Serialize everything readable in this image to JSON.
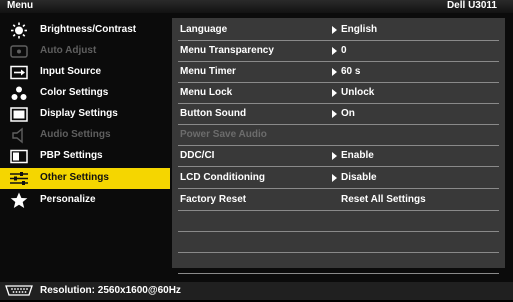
{
  "header": {
    "title": "Menu",
    "model": "Dell U3011"
  },
  "sidebar": {
    "items": [
      {
        "label": "Brightness/Contrast",
        "icon": "brightness-icon",
        "state": "normal"
      },
      {
        "label": "Auto Adjust",
        "icon": "auto-adjust-icon",
        "state": "disabled"
      },
      {
        "label": "Input Source",
        "icon": "input-source-icon",
        "state": "normal"
      },
      {
        "label": "Color Settings",
        "icon": "color-settings-icon",
        "state": "normal"
      },
      {
        "label": "Display Settings",
        "icon": "display-settings-icon",
        "state": "normal"
      },
      {
        "label": "Audio Settings",
        "icon": "speaker-icon",
        "state": "disabled"
      },
      {
        "label": "PBP Settings",
        "icon": "pbp-icon",
        "state": "normal"
      },
      {
        "label": "Other Settings",
        "icon": "sliders-icon",
        "state": "selected"
      },
      {
        "label": "Personalize",
        "icon": "star-icon",
        "state": "normal"
      }
    ]
  },
  "settings": {
    "rows": [
      {
        "name": "Language",
        "value": "English",
        "arrow": true,
        "disabled": false
      },
      {
        "name": "Menu Transparency",
        "value": "0",
        "arrow": true,
        "disabled": false
      },
      {
        "name": "Menu Timer",
        "value": "60 s",
        "arrow": true,
        "disabled": false
      },
      {
        "name": "Menu Lock",
        "value": "Unlock",
        "arrow": true,
        "disabled": false
      },
      {
        "name": "Button Sound",
        "value": "On",
        "arrow": true,
        "disabled": false
      },
      {
        "name": "Power Save Audio",
        "value": "",
        "arrow": false,
        "disabled": true
      },
      {
        "name": "DDC/CI",
        "value": "Enable",
        "arrow": true,
        "disabled": false
      },
      {
        "name": "LCD Conditioning",
        "value": "Disable",
        "arrow": true,
        "disabled": false
      },
      {
        "name": "Factory Reset",
        "value": "Reset All Settings",
        "arrow": false,
        "disabled": false
      },
      {
        "name": "",
        "value": "",
        "arrow": false,
        "disabled": false
      },
      {
        "name": "",
        "value": "",
        "arrow": false,
        "disabled": false
      },
      {
        "name": "",
        "value": "",
        "arrow": false,
        "disabled": false
      }
    ]
  },
  "footer": {
    "resolution": "Resolution: 2560x1600@60Hz",
    "icon": "input-connector-icon"
  },
  "colors": {
    "accent": "#f5d600",
    "panel": "#393939",
    "background": "#0b0b0b",
    "disabled_text": "#5f5f5f"
  }
}
